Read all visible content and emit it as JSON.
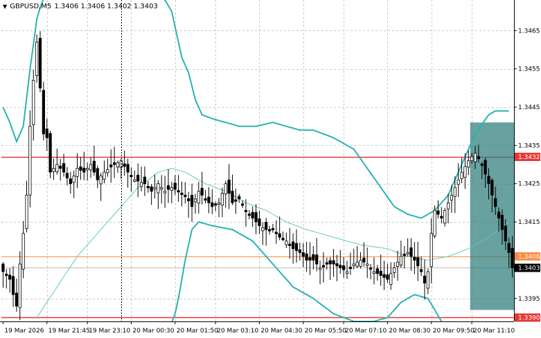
{
  "header": {
    "arrow_glyph": "▼",
    "symbol": "GBPUSD,M5",
    "ohlc": "1.3406 1.3406 1.3402 1.3403"
  },
  "axis": {
    "y_ticks": [
      "1.3465",
      "1.3455",
      "1.3445",
      "1.3435",
      "1.3425",
      "1.3415",
      "1.3395"
    ],
    "x_ticks": [
      "19 Mar 2026",
      "19 Mar 21:45",
      "19 Mar 23:10",
      "20 Mar 00:30",
      "20 Mar 01:50",
      "20 Mar 03:10",
      "20 Mar 04:30",
      "20 Mar 05:50",
      "20 Mar 07:10",
      "20 Mar 08:30",
      "20 Mar 09:50",
      "20 Mar 11:10"
    ]
  },
  "price_tags": [
    {
      "label": "1.3432",
      "price": 1.3432,
      "bg": "#e53935",
      "fg": "#ffffff"
    },
    {
      "label": "1.3406",
      "price": 1.3406,
      "bg": "#ff8c42",
      "fg": "#ffffff"
    },
    {
      "label": "1.3403",
      "price": 1.3403,
      "bg": "#000000",
      "fg": "#ffffff"
    },
    {
      "label": "1.3390",
      "price": 1.339,
      "bg": "#e53935",
      "fg": "#ffffff"
    }
  ],
  "colors": {
    "grid": "#c8c8c8",
    "candle": "#000000",
    "band": "#2ab3b0",
    "band_mid": "#5cc8c4",
    "level_red": "#e53935",
    "level_orange": "#ff8c42",
    "current_line": "#bbbbbb",
    "box_fill": "#2e7d7a",
    "box_opacity": 0.72
  },
  "chart_data": {
    "type": "candlestick",
    "symbol": "GBPUSD",
    "timeframe": "M5",
    "ylim": [
      1.3389,
      1.3473
    ],
    "levels": [
      {
        "price": 1.3432,
        "color": "red"
      },
      {
        "price": 1.3406,
        "color": "orange"
      },
      {
        "price": 1.3403,
        "color": "current"
      },
      {
        "price": 1.339,
        "color": "red"
      }
    ],
    "selection_box": {
      "from_index": 139,
      "to_index": 151,
      "price_high": 1.3441,
      "price_low": 1.3392
    },
    "crosshair_index": 35,
    "close_path": [
      [
        0,
        1.3402
      ],
      [
        2,
        1.34
      ],
      [
        3,
        1.3396
      ],
      [
        4,
        1.3393
      ],
      [
        5,
        1.3404
      ],
      [
        6,
        1.3412
      ],
      [
        7,
        1.3422
      ],
      [
        8,
        1.344
      ],
      [
        9,
        1.3452
      ],
      [
        10,
        1.3462
      ],
      [
        11,
        1.345
      ],
      [
        12,
        1.3438
      ],
      [
        13,
        1.3437
      ],
      [
        14,
        1.3428
      ],
      [
        16,
        1.343
      ],
      [
        18,
        1.3428
      ],
      [
        20,
        1.3425
      ],
      [
        22,
        1.3429
      ],
      [
        24,
        1.3428
      ],
      [
        26,
        1.343
      ],
      [
        28,
        1.3426
      ],
      [
        30,
        1.3428
      ],
      [
        33,
        1.343
      ],
      [
        35,
        1.3431
      ],
      [
        37,
        1.3428
      ],
      [
        39,
        1.3426
      ],
      [
        42,
        1.3425
      ],
      [
        44,
        1.3423
      ],
      [
        46,
        1.3425
      ],
      [
        48,
        1.3423
      ],
      [
        50,
        1.3424
      ],
      [
        52,
        1.3423
      ],
      [
        54,
        1.3422
      ],
      [
        56,
        1.3419
      ],
      [
        58,
        1.3423
      ],
      [
        60,
        1.3421
      ],
      [
        62,
        1.3419
      ],
      [
        64,
        1.342
      ],
      [
        66,
        1.3425
      ],
      [
        68,
        1.342
      ],
      [
        70,
        1.3421
      ],
      [
        72,
        1.3418
      ],
      [
        74,
        1.3416
      ],
      [
        76,
        1.3414
      ],
      [
        78,
        1.3413
      ],
      [
        80,
        1.3413
      ],
      [
        82,
        1.3411
      ],
      [
        84,
        1.341
      ],
      [
        86,
        1.3408
      ],
      [
        88,
        1.3407
      ],
      [
        90,
        1.3405
      ],
      [
        92,
        1.3405
      ],
      [
        94,
        1.3403
      ],
      [
        96,
        1.3404
      ],
      [
        98,
        1.3404
      ],
      [
        100,
        1.3403
      ],
      [
        102,
        1.3402
      ],
      [
        104,
        1.3404
      ],
      [
        106,
        1.3405
      ],
      [
        108,
        1.3404
      ],
      [
        110,
        1.3402
      ],
      [
        112,
        1.3401
      ],
      [
        114,
        1.34
      ],
      [
        116,
        1.3403
      ],
      [
        118,
        1.3406
      ],
      [
        120,
        1.3407
      ],
      [
        122,
        1.3405
      ],
      [
        124,
        1.3402
      ],
      [
        125,
        1.3399
      ],
      [
        126,
        1.3402
      ],
      [
        127,
        1.3412
      ],
      [
        128,
        1.3418
      ],
      [
        130,
        1.3416
      ],
      [
        132,
        1.342
      ],
      [
        134,
        1.3424
      ],
      [
        136,
        1.3428
      ],
      [
        138,
        1.3431
      ],
      [
        140,
        1.3433
      ],
      [
        142,
        1.343
      ],
      [
        144,
        1.3425
      ],
      [
        146,
        1.3419
      ],
      [
        148,
        1.3413
      ],
      [
        150,
        1.3407
      ],
      [
        151,
        1.3403
      ]
    ],
    "bollinger": {
      "upper": [
        [
          0,
          1.3445
        ],
        [
          2,
          1.3441
        ],
        [
          4,
          1.3436
        ],
        [
          6,
          1.344
        ],
        [
          8,
          1.3455
        ],
        [
          10,
          1.3468
        ],
        [
          12,
          1.3474
        ],
        [
          16,
          1.3479
        ],
        [
          24,
          1.348
        ],
        [
          32,
          1.348
        ],
        [
          40,
          1.3479
        ],
        [
          46,
          1.3476
        ],
        [
          50,
          1.347
        ],
        [
          53,
          1.3458
        ],
        [
          55,
          1.3454
        ],
        [
          57,
          1.3447
        ],
        [
          59,
          1.3443
        ],
        [
          62,
          1.3442
        ],
        [
          66,
          1.3441
        ],
        [
          70,
          1.344
        ],
        [
          75,
          1.344
        ],
        [
          80,
          1.3441
        ],
        [
          84,
          1.344
        ],
        [
          88,
          1.3439
        ],
        [
          92,
          1.3439
        ],
        [
          98,
          1.3437
        ],
        [
          104,
          1.3434
        ],
        [
          108,
          1.3429
        ],
        [
          112,
          1.3424
        ],
        [
          116,
          1.3419
        ],
        [
          120,
          1.3417
        ],
        [
          124,
          1.3416
        ],
        [
          128,
          1.3418
        ],
        [
          132,
          1.3422
        ],
        [
          136,
          1.343
        ],
        [
          140,
          1.3438
        ],
        [
          144,
          1.3443
        ],
        [
          146,
          1.3444
        ],
        [
          150,
          1.3444
        ]
      ],
      "middle": [
        [
          10,
          1.339
        ],
        [
          16,
          1.3398
        ],
        [
          22,
          1.3406
        ],
        [
          28,
          1.3412
        ],
        [
          34,
          1.3418
        ],
        [
          40,
          1.3424
        ],
        [
          46,
          1.3428
        ],
        [
          50,
          1.3429
        ],
        [
          54,
          1.3428
        ],
        [
          60,
          1.3425
        ],
        [
          66,
          1.3423
        ],
        [
          72,
          1.342
        ],
        [
          78,
          1.3418
        ],
        [
          84,
          1.3415
        ],
        [
          90,
          1.3413
        ],
        [
          98,
          1.3411
        ],
        [
          106,
          1.3409
        ],
        [
          114,
          1.3408
        ],
        [
          120,
          1.3406
        ],
        [
          126,
          1.3405
        ],
        [
          132,
          1.3406
        ],
        [
          138,
          1.3408
        ],
        [
          144,
          1.3411
        ],
        [
          150,
          1.3415
        ]
      ],
      "lower": [
        [
          47,
          1.3375
        ],
        [
          52,
          1.3395
        ],
        [
          54,
          1.3405
        ],
        [
          56,
          1.3413
        ],
        [
          58,
          1.3415
        ],
        [
          62,
          1.3414
        ],
        [
          68,
          1.3413
        ],
        [
          74,
          1.341
        ],
        [
          80,
          1.3404
        ],
        [
          86,
          1.3398
        ],
        [
          92,
          1.3395
        ],
        [
          98,
          1.3391
        ],
        [
          104,
          1.3389
        ],
        [
          110,
          1.3389
        ],
        [
          114,
          1.339
        ],
        [
          118,
          1.3394
        ],
        [
          122,
          1.3396
        ],
        [
          126,
          1.3395
        ],
        [
          130,
          1.3389
        ]
      ]
    }
  }
}
